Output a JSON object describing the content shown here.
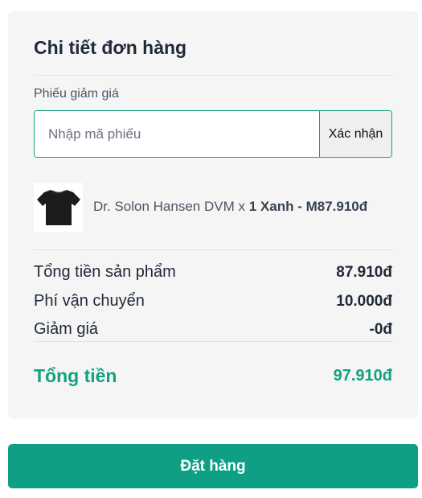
{
  "order": {
    "title": "Chi tiết đơn hàng",
    "coupon": {
      "label": "Phiếu giảm giá",
      "placeholder": "Nhập mã phiếu",
      "value": "",
      "confirm_label": "Xác nhận"
    },
    "item": {
      "name": "Dr. Solon Hansen DVM",
      "separator": " x ",
      "quantity": "1",
      "color": "Xanh",
      "dash": " - ",
      "size": "M",
      "price": "87.910đ",
      "image_icon": "tshirt-icon",
      "image_color": "#1c1c1c"
    },
    "summary": {
      "subtotal_label": "Tổng tiền sản phẩm",
      "subtotal_value": "87.910đ",
      "shipping_label": "Phí vận chuyển",
      "shipping_value": "10.000đ",
      "discount_label": "Giảm giá",
      "discount_value": "-0đ",
      "total_label": "Tổng tiền",
      "total_value": "97.910đ"
    },
    "place_order_label": "Đặt hàng"
  },
  "colors": {
    "accent": "#12a283",
    "button": "#0e9f85",
    "card_bg": "#f5f5f5"
  }
}
